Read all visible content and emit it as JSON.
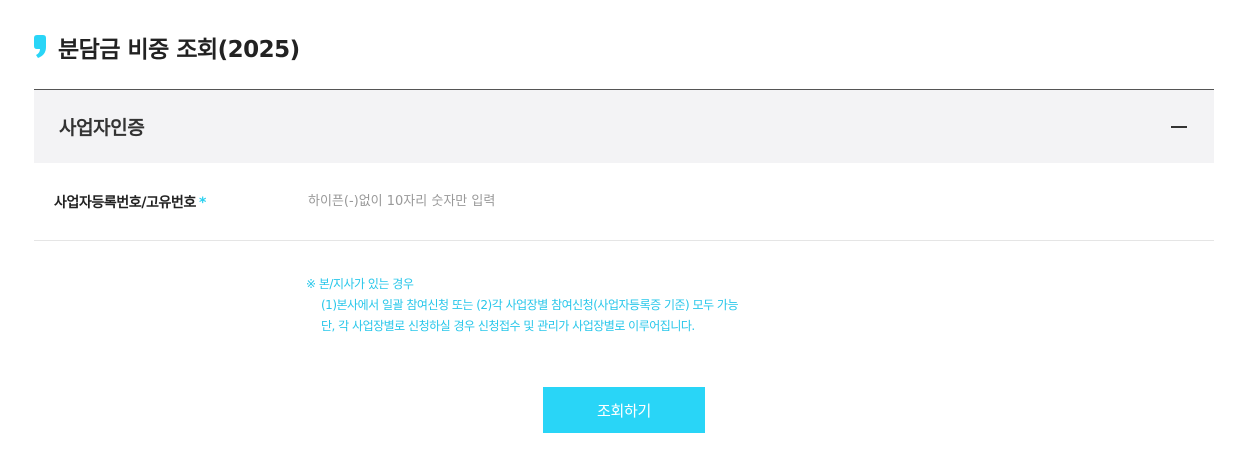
{
  "header": {
    "title": "분담금 비중 조회(2025)",
    "mark_icon": "quote-mark-icon",
    "accent_color": "#29d5f7"
  },
  "section": {
    "title": "사업자인증",
    "collapse_icon": "minus-icon"
  },
  "form": {
    "business_number": {
      "label": "사업자등록번호/고유번호",
      "required_mark": "*",
      "placeholder": "하이픈(-)없이 10자리 숫자만 입력",
      "value": ""
    }
  },
  "notice": {
    "line1": "※ 본/지사가 있는 경우",
    "line2": "(1)본사에서 일괄 참여신청 또는 (2)각 사업장별 참여신청(사업자등록증 기준) 모두 가능",
    "line3": "단, 각 사업장별로 신청하실 경우 신청접수 및 관리가 사업장별로 이루어집니다."
  },
  "actions": {
    "submit_label": "조회하기"
  }
}
